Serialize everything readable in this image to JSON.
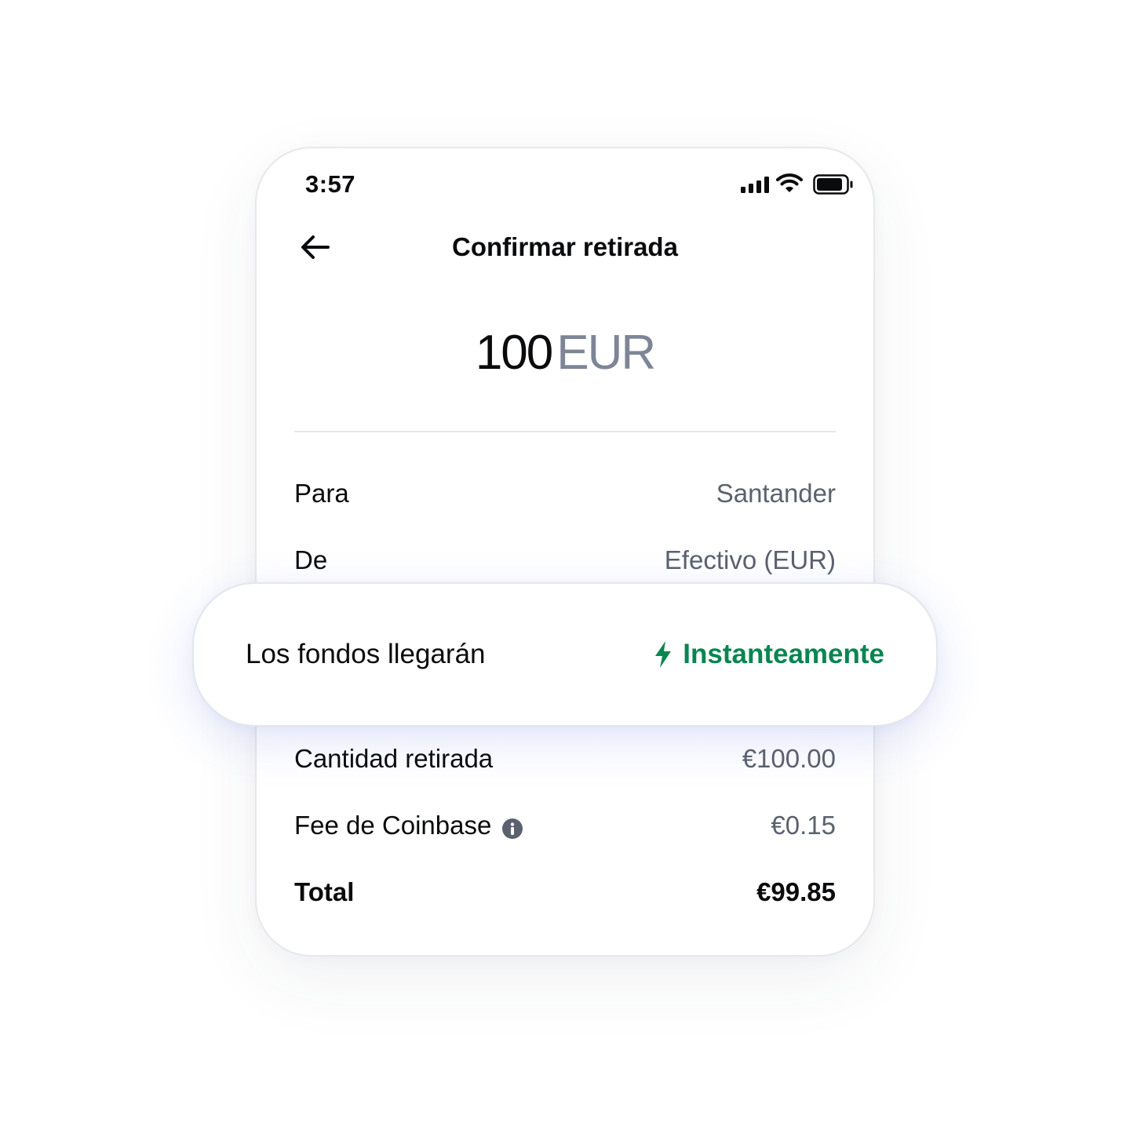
{
  "status_bar": {
    "time": "3:57",
    "icons": [
      "signal-icon",
      "wifi-icon",
      "battery-icon"
    ]
  },
  "header": {
    "back_icon": "arrow-left-icon",
    "title": "Confirmar retirada"
  },
  "amount": {
    "value": "100",
    "currency": "EUR"
  },
  "details": {
    "to_label": "Para",
    "to_value": "Santander",
    "from_label": "De",
    "from_value": "Efectivo (EUR)",
    "arrival_label": "Los fondos llegarán",
    "arrival_value": "Instanteamente",
    "arrival_icon": "lightning-bolt-icon",
    "withdraw_label": "Cantidad retirada",
    "withdraw_value": "€100.00",
    "fee_label": "Fee de Coinbase",
    "fee_icon": "info-icon",
    "fee_value": "€0.15",
    "total_label": "Total",
    "total_value": "€99.85"
  },
  "colors": {
    "text_primary": "#0a0b0d",
    "text_secondary": "#5b616e",
    "currency_muted": "#7d8597",
    "accent_green": "#098551",
    "divider": "#e6e8eb"
  }
}
